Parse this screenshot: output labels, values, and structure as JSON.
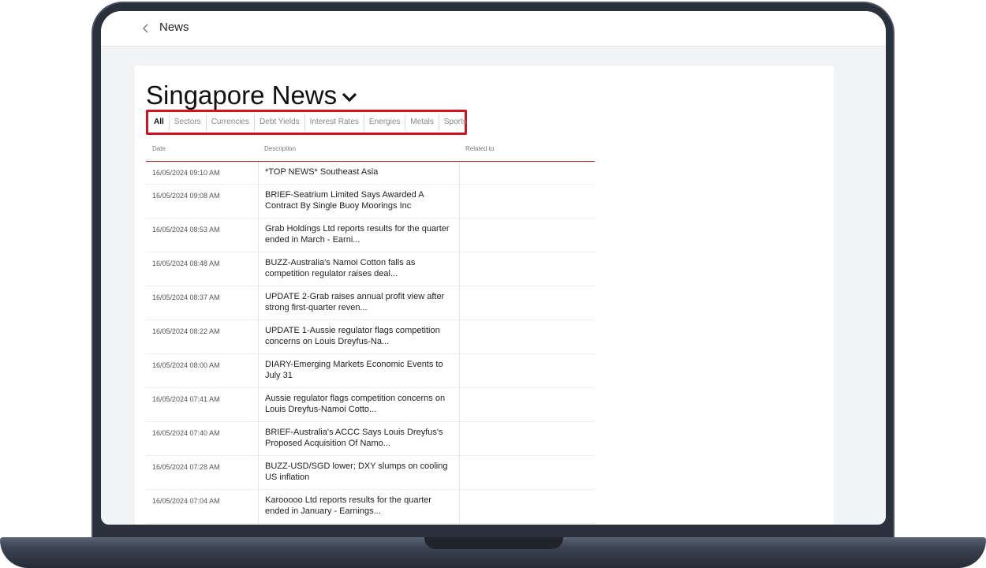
{
  "header": {
    "title": "News"
  },
  "page": {
    "title": "Singapore News"
  },
  "tabs": [
    {
      "label": "All",
      "active": true
    },
    {
      "label": "Sectors"
    },
    {
      "label": "Currencies"
    },
    {
      "label": "Debt Yields"
    },
    {
      "label": "Interest Rates"
    },
    {
      "label": "Energies"
    },
    {
      "label": "Metals"
    },
    {
      "label": "Sports"
    }
  ],
  "table": {
    "columns": {
      "date": "Date",
      "description": "Description",
      "related": "Related to"
    },
    "rows": [
      {
        "date": "16/05/2024 09:10 AM",
        "description": "*TOP NEWS* Southeast Asia",
        "related": ""
      },
      {
        "date": "16/05/2024 09:08 AM",
        "description": "BRIEF-Seatrium Limited Says Awarded A Contract By Single Buoy Moorings Inc",
        "related": ""
      },
      {
        "date": "16/05/2024 08:53 AM",
        "description": "Grab Holdings Ltd reports results for the quarter ended in March - Earni...",
        "related": ""
      },
      {
        "date": "16/05/2024 08:48 AM",
        "description": "BUZZ-Australia's Namoi Cotton falls as competition regulator raises deal...",
        "related": ""
      },
      {
        "date": "16/05/2024 08:37 AM",
        "description": "UPDATE 2-Grab raises annual profit view after strong first-quarter reven...",
        "related": ""
      },
      {
        "date": "16/05/2024 08:22 AM",
        "description": "UPDATE 1-Aussie regulator flags competition concerns on Louis Dreyfus-Na...",
        "related": ""
      },
      {
        "date": "16/05/2024 08:00 AM",
        "description": "DIARY-Emerging Markets Economic Events to July 31",
        "related": ""
      },
      {
        "date": "16/05/2024 07:41 AM",
        "description": "Aussie regulator flags competition concerns on Louis Dreyfus-Namoi Cotto...",
        "related": ""
      },
      {
        "date": "16/05/2024 07:40 AM",
        "description": "BRIEF-Australia's ACCC Says Louis Dreyfus's Proposed Acquisition Of Namo...",
        "related": ""
      },
      {
        "date": "16/05/2024 07:28 AM",
        "description": "BUZZ-USD/SGD lower; DXY slumps on cooling US inflation",
        "related": ""
      },
      {
        "date": "16/05/2024 07:04 AM",
        "description": "Karooooo Ltd reports results for the quarter ended in January - Earnings...",
        "related": ""
      }
    ]
  },
  "colors": {
    "accent": "#d4121e",
    "frame": "#2a313d"
  },
  "icons": {
    "back": "chevron-left-icon",
    "title_dropdown": "chevron-down-icon"
  }
}
